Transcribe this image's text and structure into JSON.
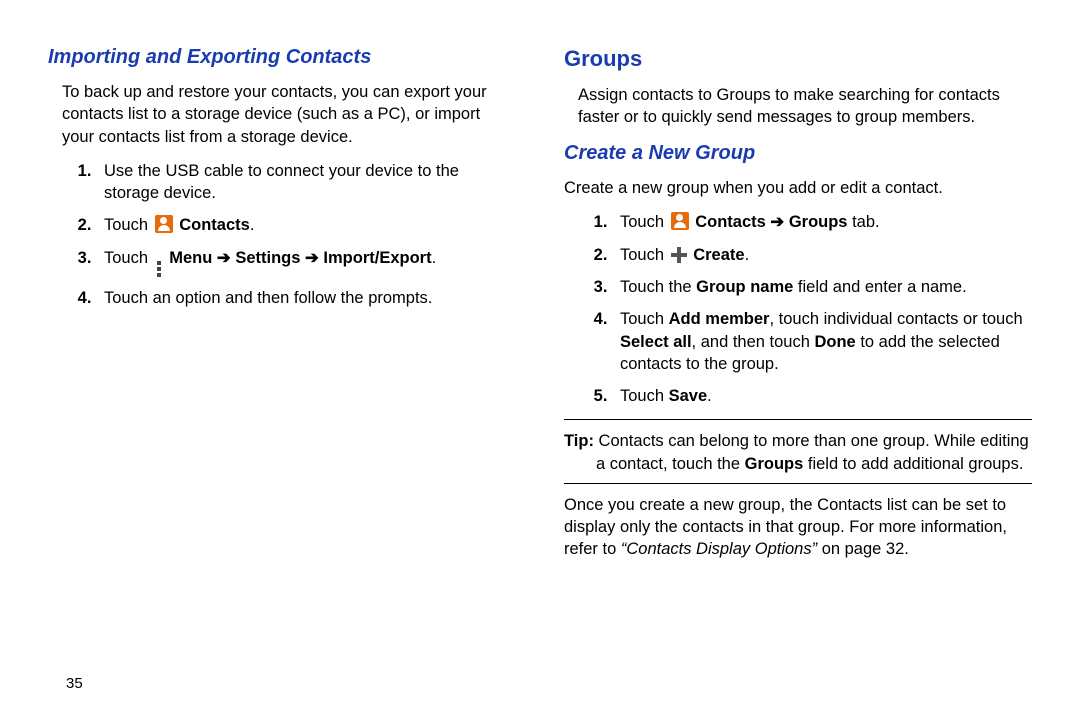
{
  "left": {
    "heading": "Importing and Exporting Contacts",
    "intro": "To back up and restore your contacts, you can export your contacts list to a storage device (such as a PC), or import your contacts list from a storage device.",
    "steps": {
      "1": "Use the USB cable to connect your device to the storage device.",
      "2_touch": "Touch ",
      "2_contacts": "Contacts",
      "2_end": ".",
      "3_touch": "Touch ",
      "3_menu": "Menu",
      "3_arrow1": " ➔ ",
      "3_settings": "Settings",
      "3_arrow2": " ➔ ",
      "3_ie": "Import/Export",
      "3_end": ".",
      "4": "Touch an option and then follow the prompts."
    }
  },
  "right": {
    "groups_heading": "Groups",
    "groups_intro": "Assign contacts to Groups to make searching for contacts faster or to quickly send messages to group members.",
    "create_heading": "Create a New Group",
    "create_intro": "Create a new group when you add or edit a contact.",
    "steps": {
      "1_touch": "Touch ",
      "1_contacts": "Contacts",
      "1_arrow": " ➔ ",
      "1_groups": "Groups",
      "1_tab": " tab.",
      "2_touch": "Touch ",
      "2_create": "Create",
      "2_end": ".",
      "3_a": "Touch the ",
      "3_b": "Group name",
      "3_c": " field and enter a name.",
      "4_a": "Touch ",
      "4_b": "Add member",
      "4_c": ", touch individual contacts or touch ",
      "4_d": "Select all",
      "4_e": ", and then touch ",
      "4_f": "Done",
      "4_g": " to add the selected contacts to the group.",
      "5_a": "Touch ",
      "5_b": "Save",
      "5_c": "."
    },
    "tip_label": "Tip:",
    "tip_a": " Contacts can belong to more than one group. While editing a contact, touch the ",
    "tip_b": "Groups",
    "tip_c": " field to add additional groups.",
    "after_a": "Once you create a new group, the Contacts list can be set to display only the contacts in that group. For more information, refer to ",
    "after_b": "“Contacts Display Options”",
    "after_c": " on page 32."
  },
  "page_number": "35"
}
